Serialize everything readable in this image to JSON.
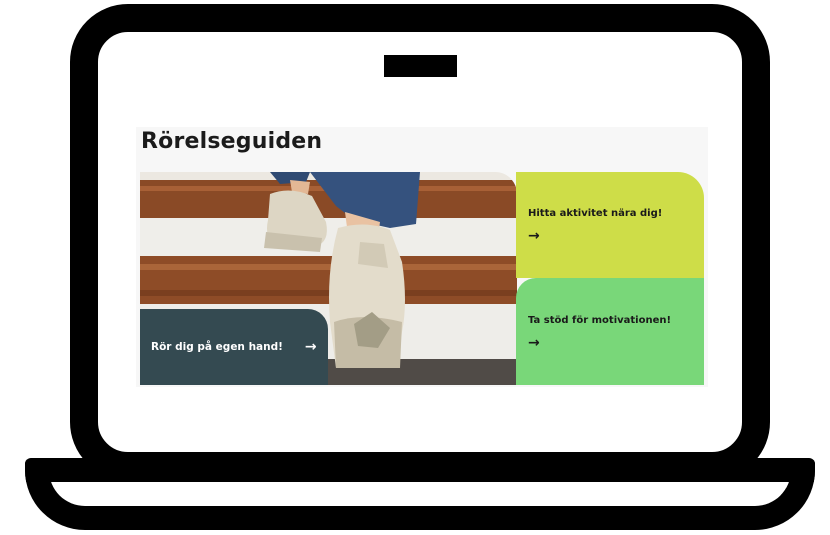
{
  "page": {
    "title": "Rörelseguiden"
  },
  "tiles": {
    "find_activity": {
      "label": "Hitta aktivitet nära dig!",
      "arrow": "→",
      "color": "#cedd48"
    },
    "motivation": {
      "label": "Ta stöd för motivationen!",
      "arrow": "→",
      "color": "#79d779"
    },
    "on_your_own": {
      "label": "Rör dig på egen hand!",
      "arrow": "→",
      "color": "#344a51"
    }
  },
  "frame": {
    "color": "#000000"
  }
}
